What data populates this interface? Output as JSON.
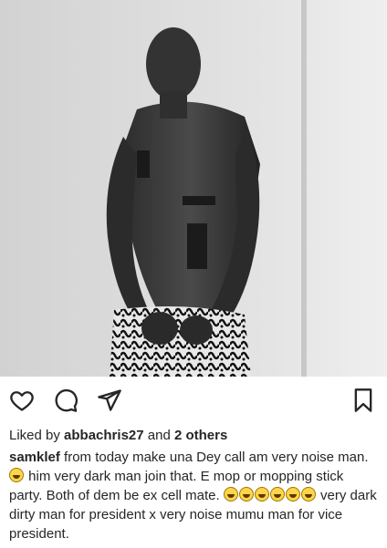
{
  "post": {
    "photo_alt": "black and white photo of a shirtless tattooed man in patterned shorts",
    "icons": {
      "like": "heart-icon",
      "comment": "comment-icon",
      "share": "send-icon",
      "save": "bookmark-icon"
    },
    "likes": {
      "prefix": "Liked by ",
      "user": "abbachris27",
      "middle": " and ",
      "others": "2 others"
    },
    "caption": {
      "username": "samklef",
      "text_1": " from today make una Dey call am very noise man. ",
      "text_2": " him very dark man join that. E mop or mopping stick party.  Both of dem be  ex cell mate. ",
      "text_3": " very dark dirty man for president x very noise mumu man for vice president.",
      "emoji_name": "face-with-tears-of-joy"
    }
  }
}
